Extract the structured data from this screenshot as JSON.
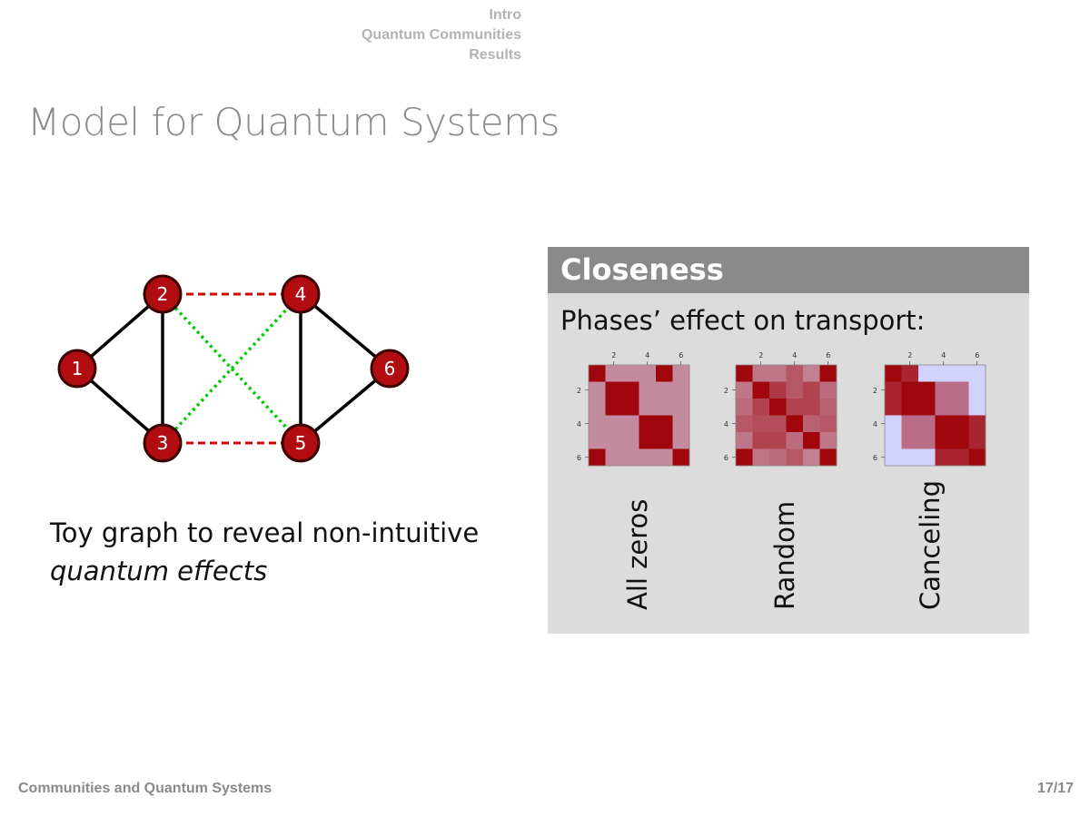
{
  "nav": {
    "sections": [
      "Intro",
      "Quantum Communities",
      "Results"
    ]
  },
  "title": "Model for Quantum Systems",
  "graph": {
    "nodes": [
      "1",
      "2",
      "3",
      "4",
      "5",
      "6"
    ],
    "edges": {
      "solid": [
        [
          "1",
          "2"
        ],
        [
          "1",
          "3"
        ],
        [
          "2",
          "3"
        ],
        [
          "4",
          "5"
        ],
        [
          "4",
          "6"
        ],
        [
          "5",
          "6"
        ]
      ],
      "red_dashed": [
        [
          "2",
          "4"
        ],
        [
          "3",
          "5"
        ]
      ],
      "green_dotted": [
        [
          "2",
          "5"
        ],
        [
          "3",
          "4"
        ]
      ]
    },
    "colors": {
      "node_fill": "#b10d10",
      "node_stroke": "#4a0000",
      "solid_edge": "#000000",
      "red_dashed_edge": "#d40000",
      "green_dotted_edge": "#00cc00"
    }
  },
  "caption": {
    "plain": "Toy graph to reveal non-intuitive",
    "italic": "quantum effects"
  },
  "block": {
    "header": "Closeness",
    "intro": "Phases’ effect on transport:",
    "colors": {
      "header_bg": "#8a8a8a",
      "body_bg": "#dcdcdc"
    }
  },
  "chart_data": [
    {
      "type": "heatmap",
      "label": "All zeros",
      "x_ticks": [
        "2",
        "4",
        "6"
      ],
      "y_ticks": [
        "2",
        "4",
        "6"
      ],
      "matrix": [
        [
          1,
          0.35,
          0.35,
          0.35,
          1,
          0.35
        ],
        [
          0.35,
          1,
          1,
          0.35,
          0.35,
          0.35
        ],
        [
          0.35,
          1,
          1,
          0.35,
          0.35,
          0.35
        ],
        [
          0.35,
          0.35,
          0.35,
          1,
          1,
          0.35
        ],
        [
          0.35,
          0.35,
          0.35,
          1,
          1,
          0.35
        ],
        [
          1,
          0.35,
          0.35,
          0.35,
          0.35,
          1
        ]
      ]
    },
    {
      "type": "heatmap",
      "label": "Random",
      "x_ticks": [
        "2",
        "4",
        "6"
      ],
      "y_ticks": [
        "2",
        "4",
        "6"
      ],
      "matrix": [
        [
          1,
          0.45,
          0.45,
          0.6,
          0.4,
          1
        ],
        [
          0.45,
          1,
          0.75,
          0.6,
          0.7,
          0.5
        ],
        [
          0.5,
          0.7,
          1,
          0.7,
          0.7,
          0.55
        ],
        [
          0.6,
          0.65,
          0.65,
          1,
          0.55,
          0.6
        ],
        [
          0.45,
          0.7,
          0.7,
          0.5,
          1,
          0.45
        ],
        [
          1,
          0.45,
          0.5,
          0.6,
          0.4,
          1
        ]
      ]
    },
    {
      "type": "heatmap",
      "label": "Canceling",
      "x_ticks": [
        "2",
        "4",
        "6"
      ],
      "y_ticks": [
        "2",
        "4",
        "6"
      ],
      "matrix": [
        [
          1,
          0.85,
          0,
          0,
          0,
          0
        ],
        [
          0.85,
          1,
          1,
          0.5,
          0.5,
          0
        ],
        [
          0.85,
          1,
          1,
          0.5,
          0.5,
          0
        ],
        [
          0,
          0.5,
          0.5,
          1,
          1,
          0.85
        ],
        [
          0,
          0.5,
          0.5,
          1,
          1,
          0.85
        ],
        [
          0,
          0,
          0,
          0.85,
          0.85,
          1
        ]
      ],
      "colors": {
        "low": "#d2d2ff",
        "high": "#a0070d"
      }
    }
  ],
  "footer": {
    "left": "Communities and Quantum Systems",
    "right": "17/17"
  }
}
